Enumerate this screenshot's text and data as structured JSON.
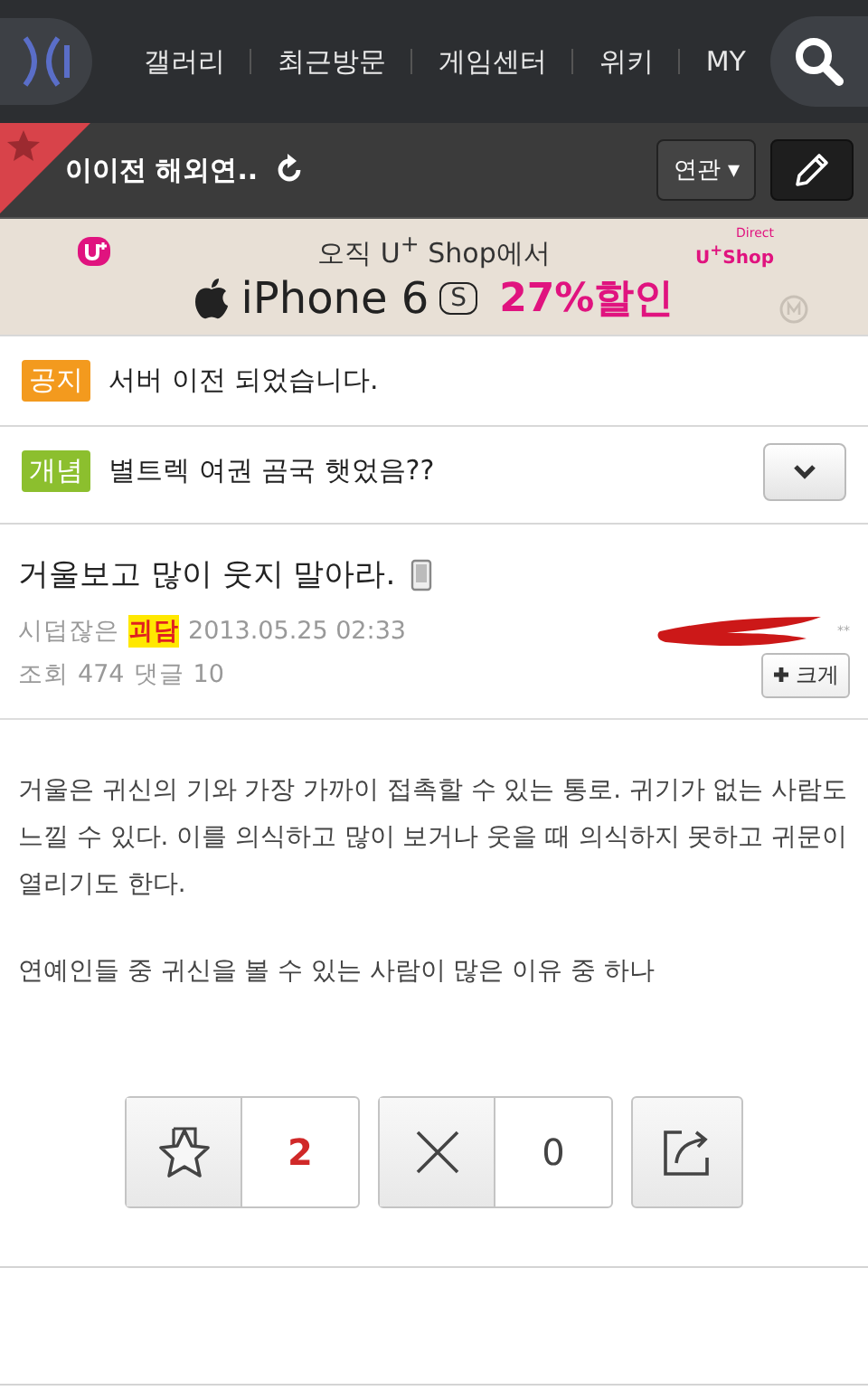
{
  "nav": {
    "items": [
      {
        "label": "갤러리"
      },
      {
        "label": "최근방문"
      },
      {
        "label": "게임센터"
      },
      {
        "label": "위키"
      },
      {
        "label": "MY"
      }
    ]
  },
  "gallery_bar": {
    "title": "이이전 해외연..",
    "favorite": true,
    "related_button": "연관 ▾"
  },
  "ad": {
    "line1": "오직 U$^{+}$ Shop에서",
    "product": "iPhone 6",
    "model_badge": "S",
    "discount": "27%할인",
    "brand": "U$^{+}$Shop",
    "brand_tag": "Direct"
  },
  "notices": [
    {
      "tag": "공지",
      "color": "#f39a1e",
      "text": "서버 이전 되었습니다.",
      "expandable": false
    },
    {
      "tag": "개념",
      "color": "#8cbf2e",
      "text": "별트렉 여권 곰국 햇었음??",
      "expandable": true
    }
  ],
  "post": {
    "title": "거울보고 많이 웃지 말아라.",
    "mobile": true,
    "category_prefix": "시덥잖은",
    "category": "괴담",
    "date": "2013.05.25 02:33",
    "author_suffix": "**",
    "views_label": "조회",
    "views": "474",
    "comments_label": "댓글",
    "comments": "10",
    "font_button": "크게",
    "body": [
      "거울은 귀신의 기와 가장 가까이 접촉할 수 있는 통로. 귀기가 없는 사람도 느낄 수 있다. 이를 의식하고 많이 보거나 웃을 때 의식하지 못하고 귀문이 열리기도 한다.",
      "연예인들 중 귀신을 볼 수 있는 사람이 많은 이유 중 하나"
    ]
  },
  "actions": {
    "recommend": "2",
    "oppose": "0"
  }
}
